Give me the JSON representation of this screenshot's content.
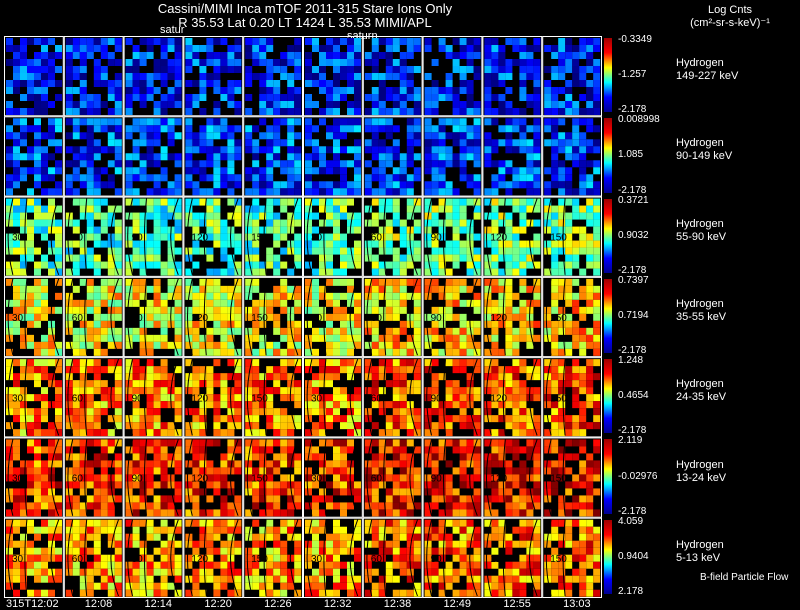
{
  "header": {
    "title_line1": "Cassini/MIMI Inca mTOF  2011-315    Stare    Ions Only",
    "title_line2": "R          35.53  Lat 0.20  LT 1424  L           35.53   MIMI/APL",
    "units_line1": "Log Cnts",
    "units_line2": "(cm²-sr-s-keV)⁻¹",
    "saturn_label": "satur",
    "saturn_label2": "saturn"
  },
  "panels": [
    {
      "species": "Hydrogen",
      "energy": "149-227 keV",
      "max": "-0.3349",
      "mid": "-1.257",
      "min": "-2.178",
      "level": 0.15
    },
    {
      "species": "Hydrogen",
      "energy": "90-149 keV",
      "max": "0.008998",
      "mid": "1.085",
      "min": "-2.178",
      "level": 0.18
    },
    {
      "species": "Hydrogen",
      "energy": "55-90 keV",
      "max": "0.3721",
      "mid": "0.9032",
      "min": "-2.178",
      "level": 0.45
    },
    {
      "species": "Hydrogen",
      "energy": "35-55 keV",
      "max": "0.7397",
      "mid": "0.7194",
      "min": "-2.178",
      "level": 0.62
    },
    {
      "species": "Hydrogen",
      "energy": "24-35 keV",
      "max": "1.248",
      "mid": "0.4654",
      "min": "-2.178",
      "level": 0.74
    },
    {
      "species": "Hydrogen",
      "energy": "13-24 keV",
      "max": "2.119",
      "mid": "-0.02976",
      "min": "-2.178",
      "level": 0.82
    },
    {
      "species": "Hydrogen",
      "energy": "5-13 keV",
      "max": "4.059",
      "mid": "0.9404",
      "min": "2.178",
      "level": 0.72
    }
  ],
  "chart_data": {
    "type": "heatmap",
    "title": "Cassini/MIMI Inca mTOF  2011-315    Stare    Ions Only",
    "colorbar_label": "Log Cnts (cm²-sr-s-keV)⁻¹",
    "time_labels": [
      "315T12:02",
      "12:08",
      "12:14",
      "12:20",
      "12:26",
      "12:32",
      "12:38",
      "12:49",
      "12:55",
      "13:03"
    ],
    "rows": [
      "149-227 keV",
      "90-149 keV",
      "55-90 keV",
      "35-55 keV",
      "24-35 keV",
      "13-24 keV",
      "5-13 keV"
    ],
    "contour_labels": [
      "30",
      "60",
      "90",
      "120",
      "150"
    ],
    "footer_note": "B-field Particle Flow"
  },
  "colors": {
    "background": "#000000",
    "frame": "#ffffff"
  }
}
